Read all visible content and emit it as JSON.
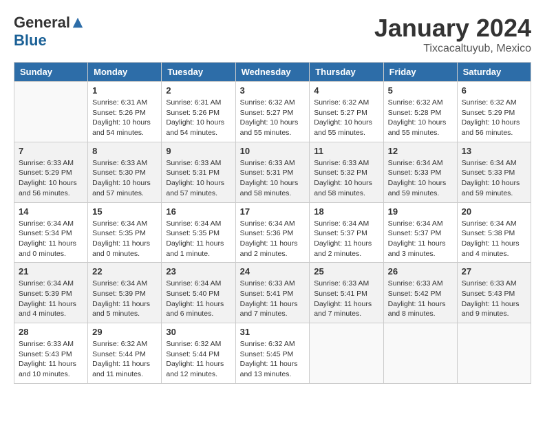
{
  "header": {
    "logo_general": "General",
    "logo_blue": "Blue",
    "month": "January 2024",
    "location": "Tixcacaltuyub, Mexico"
  },
  "days_of_week": [
    "Sunday",
    "Monday",
    "Tuesday",
    "Wednesday",
    "Thursday",
    "Friday",
    "Saturday"
  ],
  "weeks": [
    [
      {
        "day": "",
        "sunrise": "",
        "sunset": "",
        "daylight": ""
      },
      {
        "day": "1",
        "sunrise": "Sunrise: 6:31 AM",
        "sunset": "Sunset: 5:26 PM",
        "daylight": "Daylight: 10 hours and 54 minutes."
      },
      {
        "day": "2",
        "sunrise": "Sunrise: 6:31 AM",
        "sunset": "Sunset: 5:26 PM",
        "daylight": "Daylight: 10 hours and 54 minutes."
      },
      {
        "day": "3",
        "sunrise": "Sunrise: 6:32 AM",
        "sunset": "Sunset: 5:27 PM",
        "daylight": "Daylight: 10 hours and 55 minutes."
      },
      {
        "day": "4",
        "sunrise": "Sunrise: 6:32 AM",
        "sunset": "Sunset: 5:27 PM",
        "daylight": "Daylight: 10 hours and 55 minutes."
      },
      {
        "day": "5",
        "sunrise": "Sunrise: 6:32 AM",
        "sunset": "Sunset: 5:28 PM",
        "daylight": "Daylight: 10 hours and 55 minutes."
      },
      {
        "day": "6",
        "sunrise": "Sunrise: 6:32 AM",
        "sunset": "Sunset: 5:29 PM",
        "daylight": "Daylight: 10 hours and 56 minutes."
      }
    ],
    [
      {
        "day": "7",
        "sunrise": "Sunrise: 6:33 AM",
        "sunset": "Sunset: 5:29 PM",
        "daylight": "Daylight: 10 hours and 56 minutes."
      },
      {
        "day": "8",
        "sunrise": "Sunrise: 6:33 AM",
        "sunset": "Sunset: 5:30 PM",
        "daylight": "Daylight: 10 hours and 57 minutes."
      },
      {
        "day": "9",
        "sunrise": "Sunrise: 6:33 AM",
        "sunset": "Sunset: 5:31 PM",
        "daylight": "Daylight: 10 hours and 57 minutes."
      },
      {
        "day": "10",
        "sunrise": "Sunrise: 6:33 AM",
        "sunset": "Sunset: 5:31 PM",
        "daylight": "Daylight: 10 hours and 58 minutes."
      },
      {
        "day": "11",
        "sunrise": "Sunrise: 6:33 AM",
        "sunset": "Sunset: 5:32 PM",
        "daylight": "Daylight: 10 hours and 58 minutes."
      },
      {
        "day": "12",
        "sunrise": "Sunrise: 6:34 AM",
        "sunset": "Sunset: 5:33 PM",
        "daylight": "Daylight: 10 hours and 59 minutes."
      },
      {
        "day": "13",
        "sunrise": "Sunrise: 6:34 AM",
        "sunset": "Sunset: 5:33 PM",
        "daylight": "Daylight: 10 hours and 59 minutes."
      }
    ],
    [
      {
        "day": "14",
        "sunrise": "Sunrise: 6:34 AM",
        "sunset": "Sunset: 5:34 PM",
        "daylight": "Daylight: 11 hours and 0 minutes."
      },
      {
        "day": "15",
        "sunrise": "Sunrise: 6:34 AM",
        "sunset": "Sunset: 5:35 PM",
        "daylight": "Daylight: 11 hours and 0 minutes."
      },
      {
        "day": "16",
        "sunrise": "Sunrise: 6:34 AM",
        "sunset": "Sunset: 5:35 PM",
        "daylight": "Daylight: 11 hours and 1 minute."
      },
      {
        "day": "17",
        "sunrise": "Sunrise: 6:34 AM",
        "sunset": "Sunset: 5:36 PM",
        "daylight": "Daylight: 11 hours and 2 minutes."
      },
      {
        "day": "18",
        "sunrise": "Sunrise: 6:34 AM",
        "sunset": "Sunset: 5:37 PM",
        "daylight": "Daylight: 11 hours and 2 minutes."
      },
      {
        "day": "19",
        "sunrise": "Sunrise: 6:34 AM",
        "sunset": "Sunset: 5:37 PM",
        "daylight": "Daylight: 11 hours and 3 minutes."
      },
      {
        "day": "20",
        "sunrise": "Sunrise: 6:34 AM",
        "sunset": "Sunset: 5:38 PM",
        "daylight": "Daylight: 11 hours and 4 minutes."
      }
    ],
    [
      {
        "day": "21",
        "sunrise": "Sunrise: 6:34 AM",
        "sunset": "Sunset: 5:39 PM",
        "daylight": "Daylight: 11 hours and 4 minutes."
      },
      {
        "day": "22",
        "sunrise": "Sunrise: 6:34 AM",
        "sunset": "Sunset: 5:39 PM",
        "daylight": "Daylight: 11 hours and 5 minutes."
      },
      {
        "day": "23",
        "sunrise": "Sunrise: 6:34 AM",
        "sunset": "Sunset: 5:40 PM",
        "daylight": "Daylight: 11 hours and 6 minutes."
      },
      {
        "day": "24",
        "sunrise": "Sunrise: 6:33 AM",
        "sunset": "Sunset: 5:41 PM",
        "daylight": "Daylight: 11 hours and 7 minutes."
      },
      {
        "day": "25",
        "sunrise": "Sunrise: 6:33 AM",
        "sunset": "Sunset: 5:41 PM",
        "daylight": "Daylight: 11 hours and 7 minutes."
      },
      {
        "day": "26",
        "sunrise": "Sunrise: 6:33 AM",
        "sunset": "Sunset: 5:42 PM",
        "daylight": "Daylight: 11 hours and 8 minutes."
      },
      {
        "day": "27",
        "sunrise": "Sunrise: 6:33 AM",
        "sunset": "Sunset: 5:43 PM",
        "daylight": "Daylight: 11 hours and 9 minutes."
      }
    ],
    [
      {
        "day": "28",
        "sunrise": "Sunrise: 6:33 AM",
        "sunset": "Sunset: 5:43 PM",
        "daylight": "Daylight: 11 hours and 10 minutes."
      },
      {
        "day": "29",
        "sunrise": "Sunrise: 6:32 AM",
        "sunset": "Sunset: 5:44 PM",
        "daylight": "Daylight: 11 hours and 11 minutes."
      },
      {
        "day": "30",
        "sunrise": "Sunrise: 6:32 AM",
        "sunset": "Sunset: 5:44 PM",
        "daylight": "Daylight: 11 hours and 12 minutes."
      },
      {
        "day": "31",
        "sunrise": "Sunrise: 6:32 AM",
        "sunset": "Sunset: 5:45 PM",
        "daylight": "Daylight: 11 hours and 13 minutes."
      },
      {
        "day": "",
        "sunrise": "",
        "sunset": "",
        "daylight": ""
      },
      {
        "day": "",
        "sunrise": "",
        "sunset": "",
        "daylight": ""
      },
      {
        "day": "",
        "sunrise": "",
        "sunset": "",
        "daylight": ""
      }
    ]
  ]
}
